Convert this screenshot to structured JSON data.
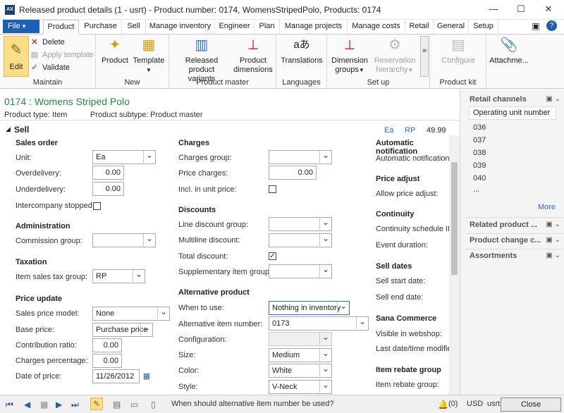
{
  "window": {
    "title": "Released product details (1 - usrt) - Product number: 0174, WomensStripedPolo, Products: 0174",
    "app_icon": "AX"
  },
  "tabs": {
    "file": "File",
    "items": [
      "Product",
      "Purchase",
      "Sell",
      "Manage inventory",
      "Engineer",
      "Plan",
      "Manage projects",
      "Manage costs",
      "Retail",
      "General",
      "Setup"
    ]
  },
  "ribbon": {
    "maintain": {
      "edit": "Edit",
      "delete": "Delete",
      "apply_template": "Apply template",
      "validate": "Validate",
      "label": "Maintain"
    },
    "new": {
      "product": "Product",
      "template": "Template",
      "label": "New"
    },
    "product_master": {
      "variants_1": "Released product",
      "variants_2": "variants",
      "dimensions_1": "Product",
      "dimensions_2": "dimensions",
      "label": "Product master"
    },
    "languages": {
      "translations": "Translations",
      "label": "Languages"
    },
    "setup": {
      "groups_1": "Dimension",
      "groups_2": "groups",
      "hierarchy_1": "Reservation",
      "hierarchy_2": "hierarchy",
      "label": "Set up"
    },
    "kit": {
      "configure": "Configure",
      "label": "Product kit"
    },
    "attach": {
      "label": "Attachme..."
    }
  },
  "header": {
    "title": "0174 : Womens Striped Polo",
    "type_label": "Product type:",
    "type_value": "Item",
    "subtype_label": "Product subtype:",
    "subtype_value": "Product master"
  },
  "section": {
    "title": "Sell",
    "unit": "Ea",
    "tax": "RP",
    "price": "49.99"
  },
  "sales_order": {
    "title": "Sales order",
    "unit_label": "Unit:",
    "unit_value": "Ea",
    "overdelivery_label": "Overdelivery:",
    "overdelivery_value": "0.00",
    "underdelivery_label": "Underdelivery:",
    "underdelivery_value": "0.00",
    "intercompany_label": "Intercompany stopped:"
  },
  "administration": {
    "title": "Administration",
    "commission_label": "Commission group:",
    "commission_value": ""
  },
  "taxation": {
    "title": "Taxation",
    "tax_group_label": "Item sales tax group:",
    "tax_group_value": "RP"
  },
  "price_update": {
    "title": "Price update",
    "model_label": "Sales price model:",
    "model_value": "None",
    "base_label": "Base price:",
    "base_value": "Purchase price",
    "ratio_label": "Contribution ratio:",
    "ratio_value": "0.00",
    "charges_pct_label": "Charges percentage:",
    "charges_pct_value": "0.00",
    "date_label": "Date of price:",
    "date_value": "11/26/2012"
  },
  "charges": {
    "title": "Charges",
    "group_label": "Charges group:",
    "group_value": "",
    "price_label": "Price charges:",
    "price_value": "0.00",
    "incl_label": "Incl. in unit price:"
  },
  "discounts": {
    "title": "Discounts",
    "line_label": "Line discount group:",
    "line_value": "",
    "multi_label": "Multiline discount:",
    "multi_value": "",
    "total_label": "Total discount:",
    "supp_label": "Supplementary item group:",
    "supp_value": ""
  },
  "alt_product": {
    "title": "Alternative product",
    "when_label": "When to use:",
    "when_value": "Nothing in inventory",
    "number_label": "Alternative item number:",
    "number_value": "0173",
    "config_label": "Configuration:",
    "config_value": "",
    "size_label": "Size:",
    "size_value": "Medium",
    "color_label": "Color:",
    "color_value": "White",
    "style_label": "Style:",
    "style_value": "V-Neck"
  },
  "col3": {
    "auto_notif_title": "Automatic notification",
    "auto_notif_label": "Automatic notification",
    "price_adjust_title": "Price adjust",
    "price_adjust_label": "Allow price adjust:",
    "continuity_title": "Continuity",
    "continuity_schedule": "Continuity schedule ID",
    "event_duration": "Event duration:",
    "sell_dates_title": "Sell dates",
    "start_label": "Sell start date:",
    "end_label": "Sell end date:",
    "sana_title": "Sana Commerce",
    "visible_label": "Visible in webshop:",
    "last_date_label": "Last date/time modifie",
    "rebate_title": "Item rebate group",
    "rebate_label": "Item rebate group:"
  },
  "right_panel": {
    "retail_channels": "Retail channels",
    "col_header": "Operating unit number",
    "channels": [
      "036",
      "037",
      "038",
      "039",
      "040",
      "..."
    ],
    "more": "More",
    "related": "Related product ...",
    "change": "Product change c...",
    "assortments": "Assortments"
  },
  "status": {
    "message": "When should alternative item number be used?",
    "count": "(0)",
    "currency": "USD",
    "company": "usrt",
    "close": "Close"
  }
}
